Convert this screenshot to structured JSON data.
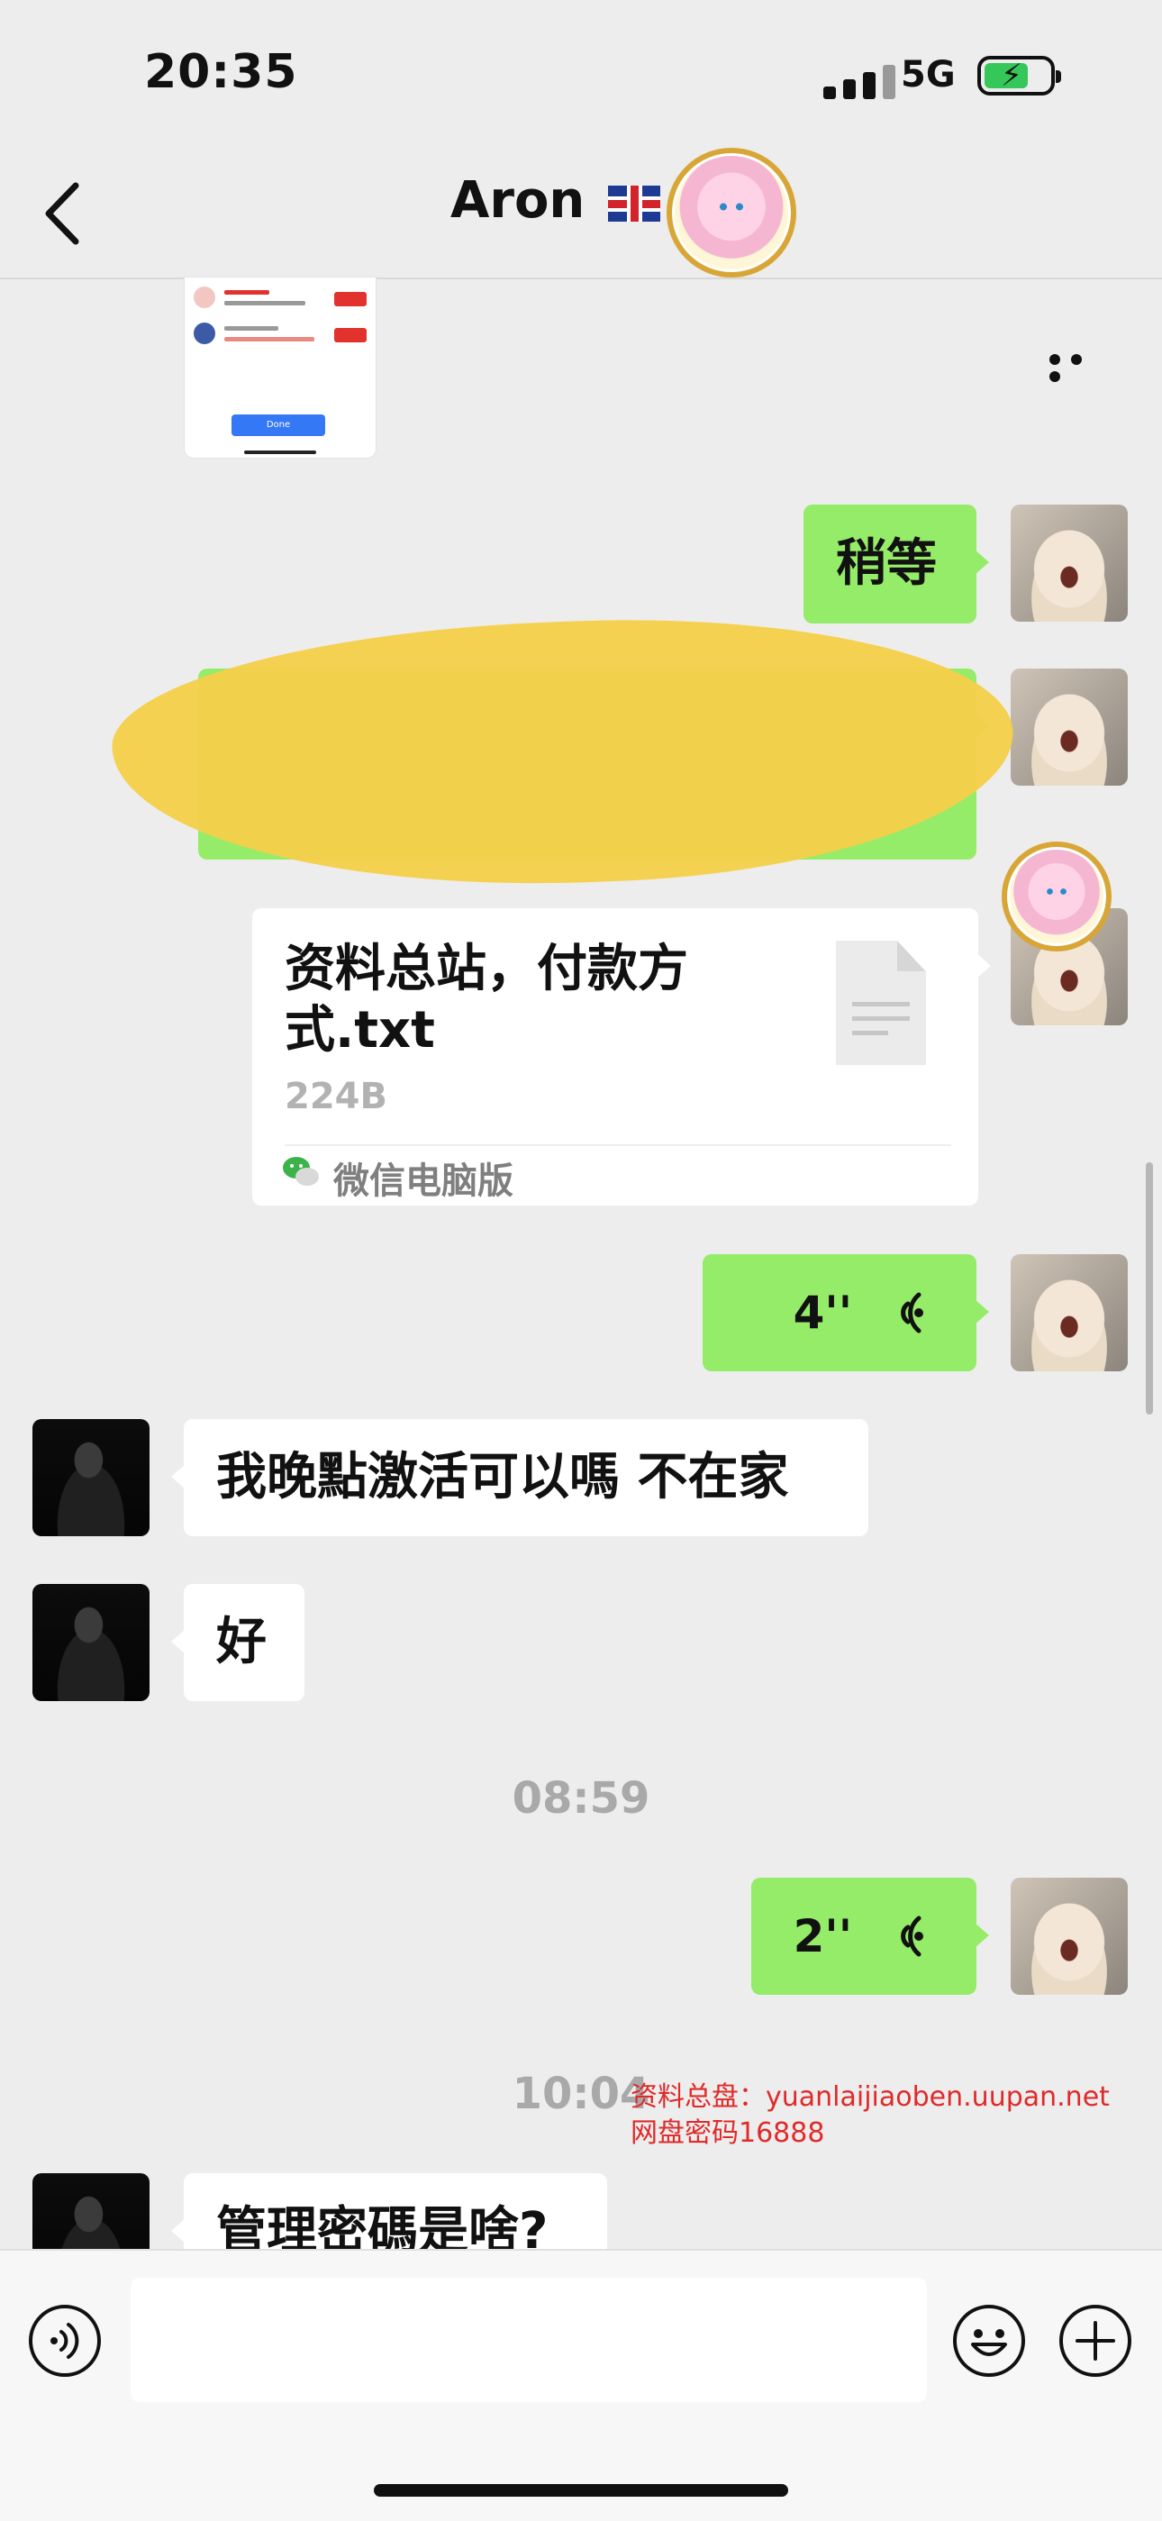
{
  "status_bar": {
    "time": "20:35",
    "network": "5G"
  },
  "nav": {
    "title": "Aron"
  },
  "messages": {
    "wait": "稍等",
    "file": {
      "name": "资料总站，付款方式.txt",
      "size": "224B",
      "source": "微信电脑版"
    },
    "voice_1": "4''",
    "reply_1": "我晚點激活可以嗎 不在家",
    "reply_2": "好",
    "time_1": "08:59",
    "voice_2": "2''",
    "time_2": "10:04",
    "reply_3": "管理密碼是啥?"
  },
  "watermark": {
    "line1": "资料总盘：yuanlaijiaoben.uupan.net",
    "line2": "网盘密码16888"
  },
  "thumbnail": {
    "done_label": "Done"
  },
  "colors": {
    "bubble_green": "#95ec69",
    "background": "#ededed",
    "highlight": "#f5cf4a"
  }
}
